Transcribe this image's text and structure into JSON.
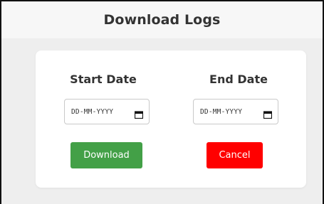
{
  "header": {
    "title": "Download Logs"
  },
  "form": {
    "start": {
      "label": "Start Date",
      "placeholder": "DD-MM-YYYY",
      "icon": "calendar-icon"
    },
    "end": {
      "label": "End Date",
      "placeholder": "DD-MM-YYYY",
      "icon": "calendar-icon"
    }
  },
  "buttons": {
    "download_label": "Download",
    "cancel_label": "Cancel"
  },
  "colors": {
    "download": "#43a047",
    "cancel": "#ff0000",
    "background": "#eeeeee",
    "card": "#ffffff"
  }
}
